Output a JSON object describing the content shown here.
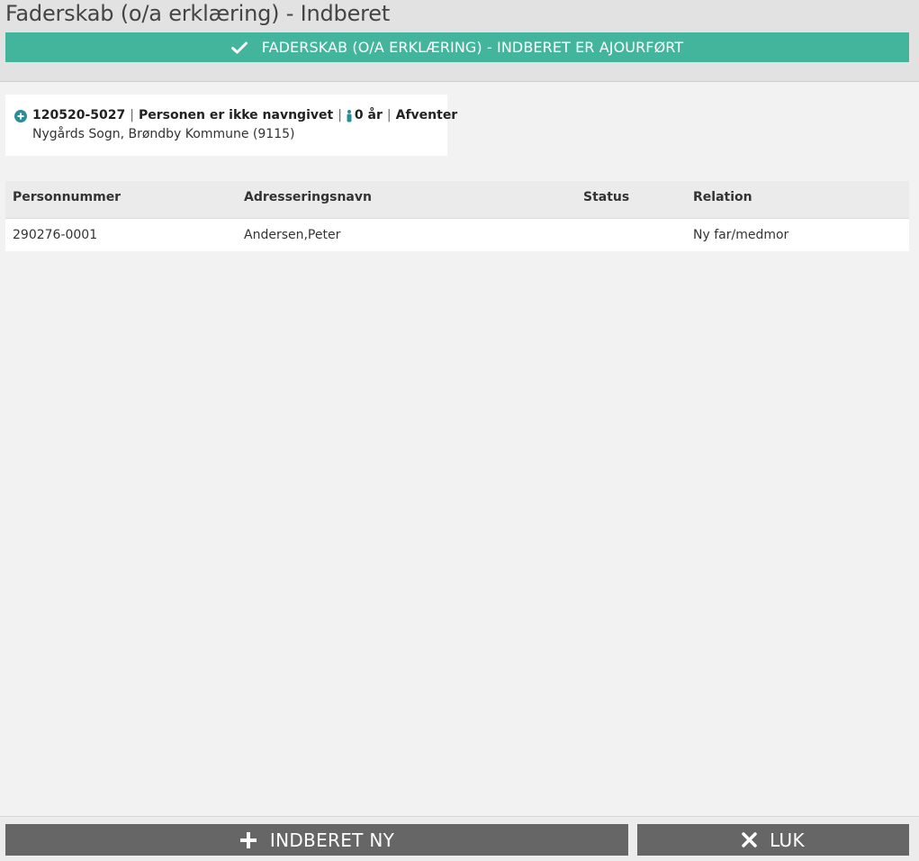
{
  "page": {
    "title": "Faderskab (o/a erklæring) - Indberet",
    "banner": "FADERSKAB (O/A ERKLÆRING) - INDBERET ER AJOURFØRT"
  },
  "person": {
    "cpr": "120520-5027",
    "name": "Personen er ikke navngivet",
    "age": "0 år",
    "status": "Afventer",
    "location": "Nygårds Sogn, Brøndby Kommune (9115)",
    "separator": "|"
  },
  "table": {
    "headers": {
      "personnummer": "Personnummer",
      "adresseringsnavn": "Adresseringsnavn",
      "status": "Status",
      "relation": "Relation"
    },
    "rows": [
      {
        "personnummer": "290276-0001",
        "adresseringsnavn": "Andersen,Peter",
        "status": "",
        "relation": "Ny far/medmor"
      }
    ]
  },
  "footer": {
    "new_label": "INDBERET NY",
    "close_label": "LUK"
  },
  "colors": {
    "banner": "#43b59c",
    "button": "#666666",
    "icon_accent": "#2a8d9a"
  },
  "icons": {
    "banner": "check-icon",
    "expand": "plus-circle-icon",
    "person": "person-icon",
    "new": "plus-icon",
    "close": "close-icon"
  }
}
